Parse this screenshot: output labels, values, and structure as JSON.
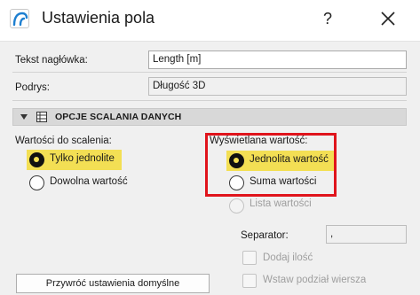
{
  "dialog": {
    "title": "Ustawienia pola",
    "help_label": "?"
  },
  "fields": {
    "header_text_label": "Tekst nagłówka:",
    "header_text_value": "Length [m]",
    "subtitle_label": "Podrys:",
    "subtitle_value": "Długość 3D"
  },
  "section": {
    "title": "OPCJE SCALANIA DANYCH"
  },
  "merge_values": {
    "label": "Wartości do scalenia:",
    "options": [
      {
        "label": "Tylko jednolite",
        "selected": true
      },
      {
        "label": "Dowolna wartość",
        "selected": false
      }
    ]
  },
  "displayed_value": {
    "label": "Wyświetlana wartość:",
    "options": [
      {
        "label": "Jednolita wartość",
        "selected": true,
        "enabled": true
      },
      {
        "label": "Suma wartości",
        "selected": false,
        "enabled": true
      },
      {
        "label": "Lista wartości",
        "selected": false,
        "enabled": false
      }
    ]
  },
  "separator": {
    "label": "Separator:",
    "value": ","
  },
  "checkboxes": [
    {
      "label": "Dodaj ilość",
      "checked": false,
      "enabled": false
    },
    {
      "label": "Wstaw podział wiersza",
      "checked": false,
      "enabled": false
    }
  ],
  "buttons": {
    "restore_defaults": "Przywróć ustawienia domyślne"
  },
  "colors": {
    "highlight": "#f3df54",
    "annotation_red": "#e0141c",
    "section_bar": "#d8d8d8",
    "app_icon_blue": "#1e7fd0"
  }
}
